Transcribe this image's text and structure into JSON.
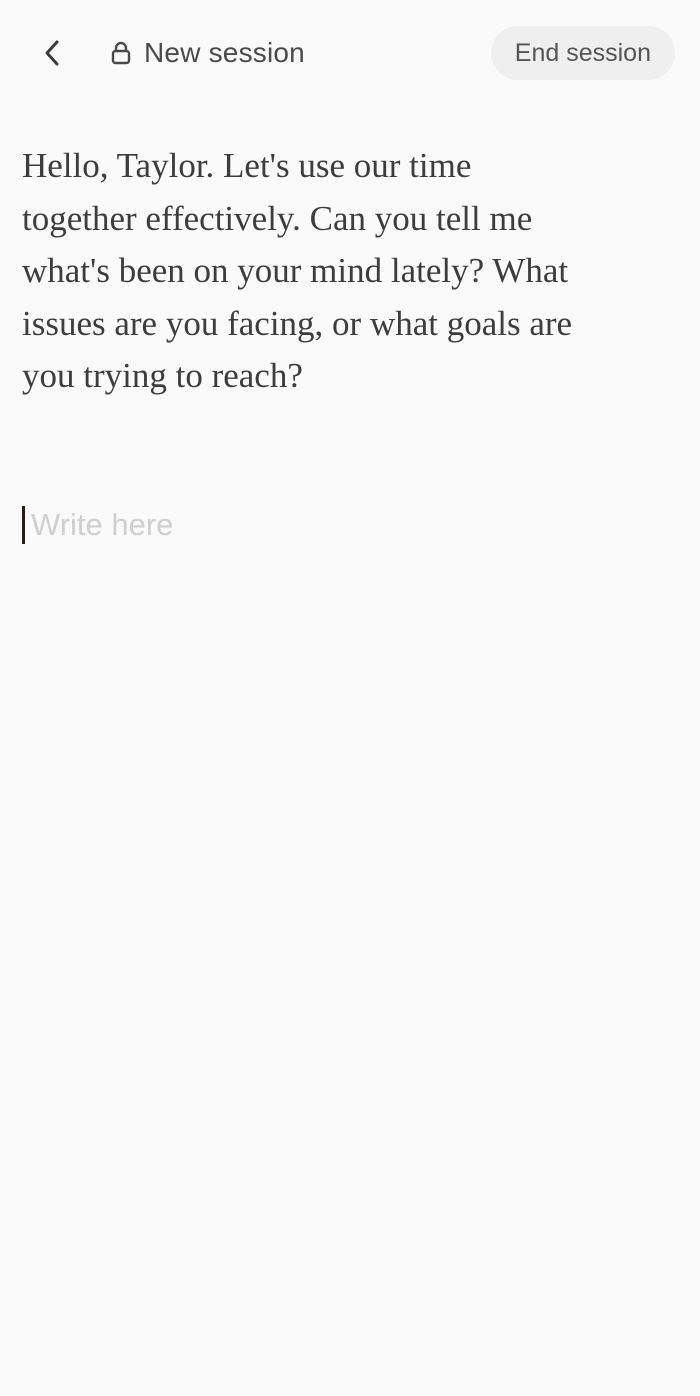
{
  "header": {
    "back_icon": "chevron-left-icon",
    "lock_icon": "lock-icon",
    "title": "New session",
    "end_button_label": "End session"
  },
  "message": {
    "text": "Hello, Taylor. Let's use our time together effectively. Can you tell me what's been on your mind lately? What issues are you facing, or what goals are you trying to reach?"
  },
  "input": {
    "placeholder": "Write here",
    "value": ""
  },
  "colors": {
    "background": "#fafafa",
    "end_button_bg": "#efefef",
    "text": "#3d3d3d",
    "placeholder": "#cfcfcf"
  }
}
